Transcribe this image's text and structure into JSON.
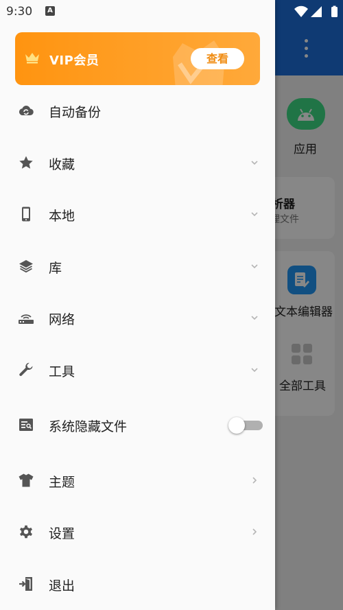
{
  "status_bar": {
    "time": "9:30",
    "notification_icon": "A"
  },
  "background_app": {
    "section_app_label": "应用",
    "analyzer_partial": "析器",
    "analyzer_sub_partial": "理文件",
    "text_editor_label": "文本编辑器",
    "all_tools_label": "全部工具"
  },
  "drawer": {
    "vip": {
      "title": "VIP会员",
      "button": "查看",
      "accent": "#ff9410"
    },
    "items": [
      {
        "label": "自动备份",
        "icon": "cloud-sync-icon",
        "trailing": "none"
      },
      {
        "label": "收藏",
        "icon": "star-icon",
        "trailing": "chevron-down"
      },
      {
        "label": "本地",
        "icon": "phone-icon",
        "trailing": "chevron-down"
      },
      {
        "label": "库",
        "icon": "layers-icon",
        "trailing": "chevron-down"
      },
      {
        "label": "网络",
        "icon": "router-icon",
        "trailing": "chevron-down"
      },
      {
        "label": "工具",
        "icon": "wrench-icon",
        "trailing": "chevron-down"
      },
      {
        "label": "系统隐藏文件",
        "icon": "hidden-files-icon",
        "trailing": "toggle",
        "toggle_on": false
      },
      {
        "label": "主题",
        "icon": "tshirt-icon",
        "trailing": "chevron-right"
      },
      {
        "label": "设置",
        "icon": "gear-icon",
        "trailing": "chevron-right"
      },
      {
        "label": "退出",
        "icon": "exit-icon",
        "trailing": "none"
      }
    ]
  },
  "colors": {
    "header_blue": "#1e6fd9",
    "icon_grey": "#555555",
    "chevron_grey": "#b5b5b5"
  }
}
